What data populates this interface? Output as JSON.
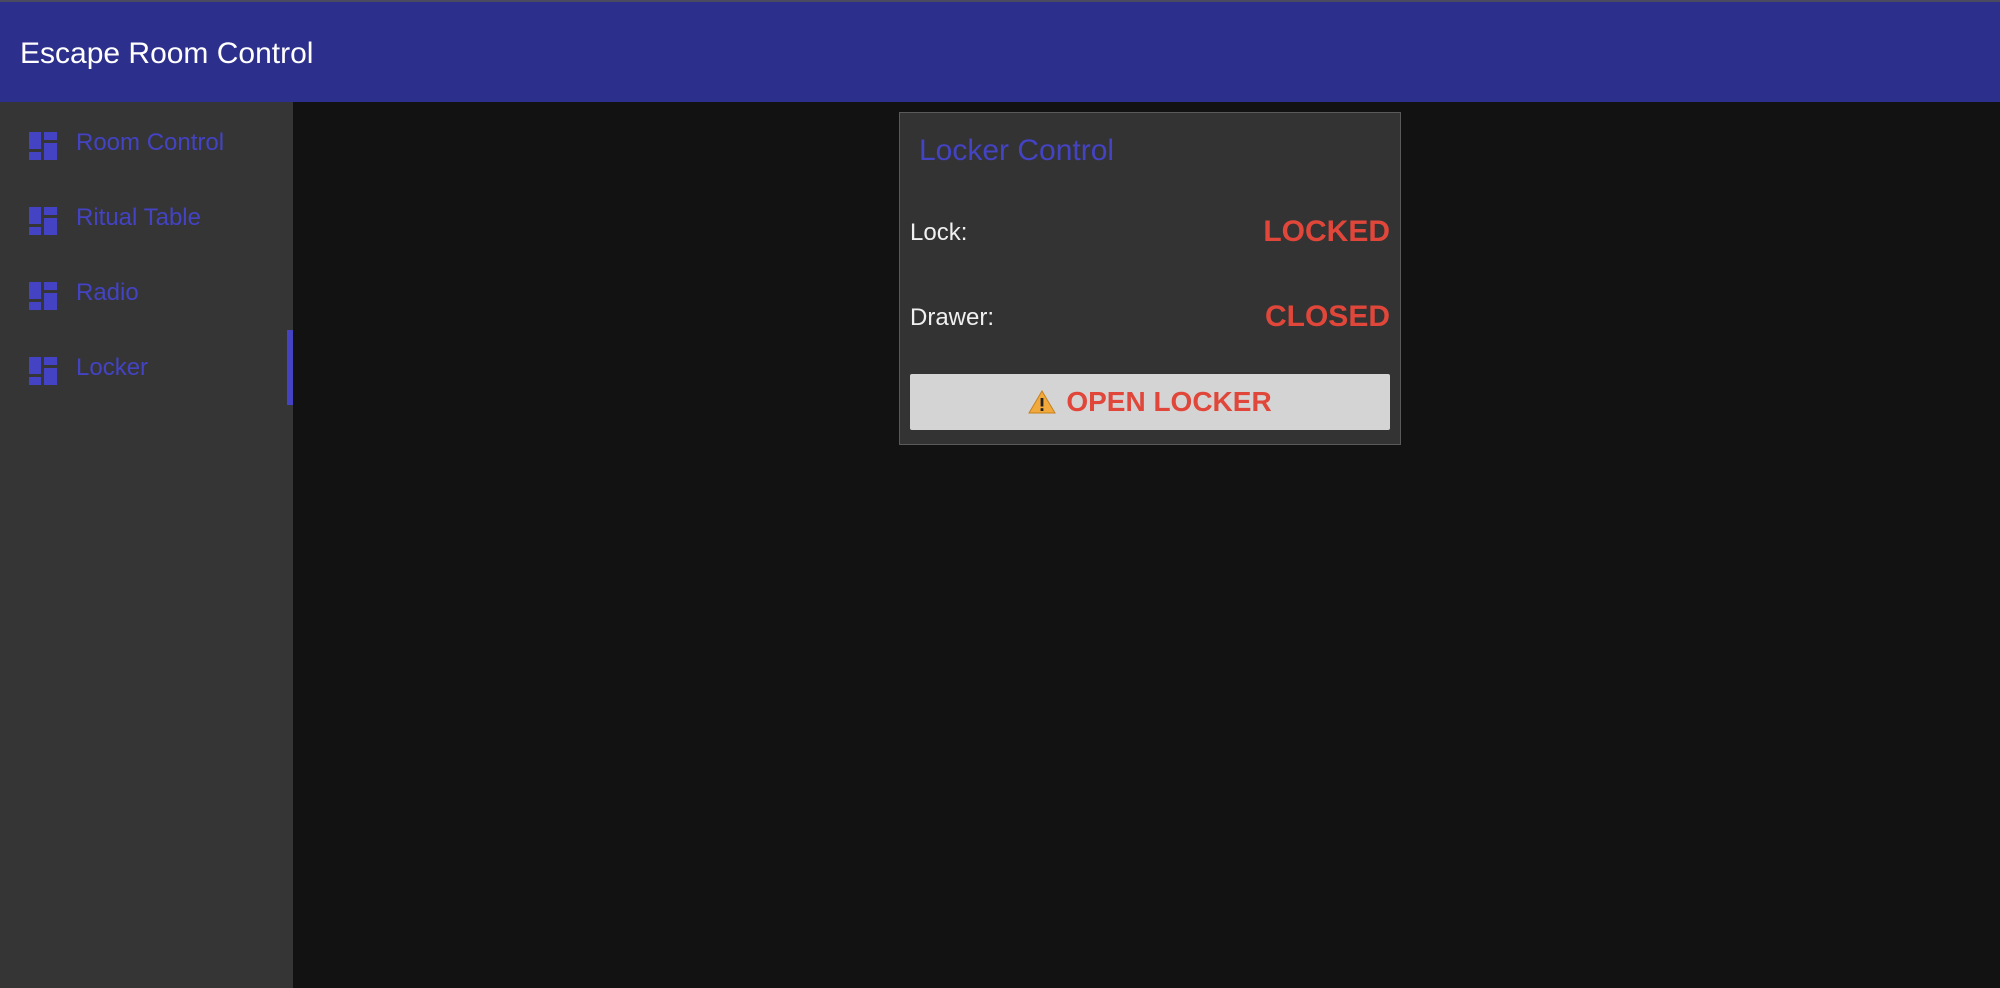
{
  "header": {
    "title": "Escape Room Control"
  },
  "sidebar": {
    "active_index": 3,
    "items": [
      {
        "label": "Room Control",
        "icon": "dashboard-icon"
      },
      {
        "label": "Ritual Table",
        "icon": "dashboard-icon"
      },
      {
        "label": "Radio",
        "icon": "dashboard-icon"
      },
      {
        "label": "Locker",
        "icon": "dashboard-icon"
      }
    ]
  },
  "card": {
    "title": "Locker Control",
    "lock_label": "Lock:",
    "lock_value": "LOCKED",
    "drawer_label": "Drawer:",
    "drawer_value": "CLOSED",
    "button_label": "OPEN LOCKER",
    "button_icon": "warning-icon"
  },
  "colors": {
    "header_bg": "#2c2f8c",
    "accent": "#4343c4",
    "status_red": "#e0473a",
    "sidebar_bg": "#353535",
    "content_bg": "#121212",
    "card_bg": "#333333"
  }
}
